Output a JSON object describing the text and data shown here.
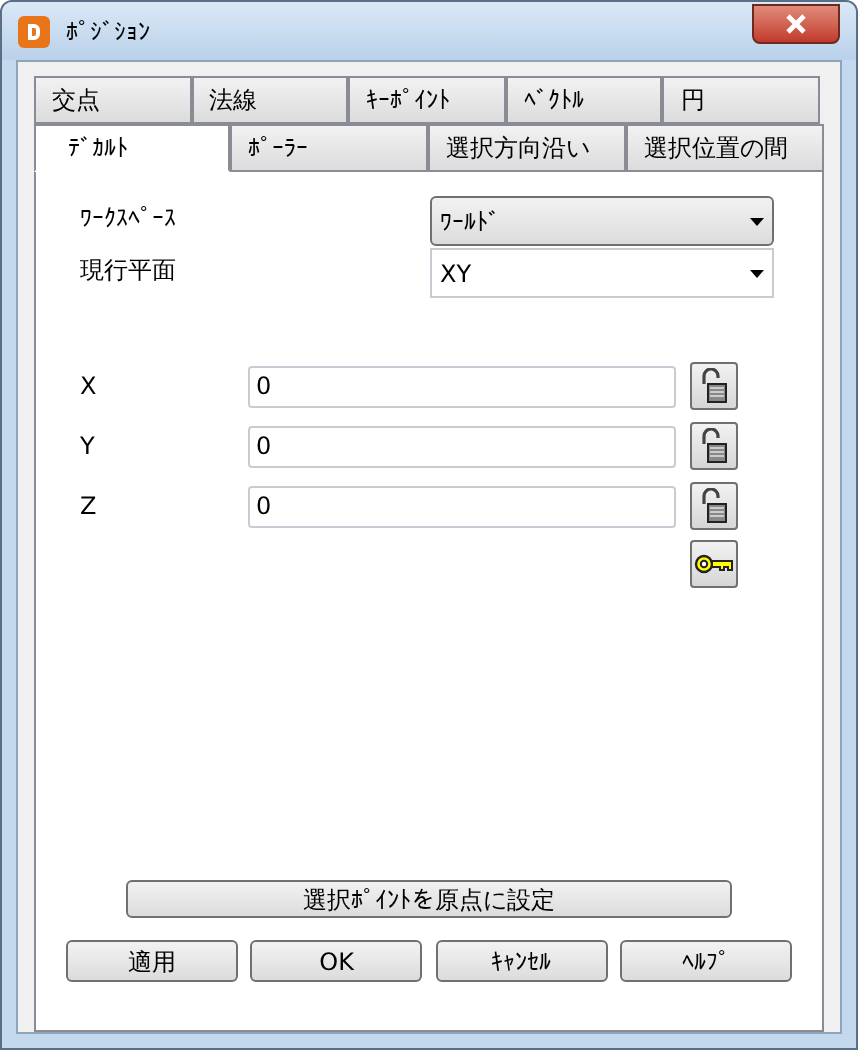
{
  "window": {
    "title": "ﾎﾟｼﾞｼｮﾝ"
  },
  "tab_rows": [
    [
      {
        "label": "交点",
        "selected": false
      },
      {
        "label": "法線",
        "selected": false
      },
      {
        "label": "ｷｰﾎﾟｲﾝﾄ",
        "selected": false
      },
      {
        "label": "ﾍﾞｸﾄﾙ",
        "selected": false
      },
      {
        "label": "円",
        "selected": false
      }
    ],
    [
      {
        "label": "ﾃﾞｶﾙﾄ",
        "selected": true
      },
      {
        "label": "ﾎﾟｰﾗｰ",
        "selected": false
      },
      {
        "label": "選択方向沿い",
        "selected": false
      },
      {
        "label": "選択位置の間",
        "selected": false
      }
    ]
  ],
  "dropdowns": [
    {
      "label": "ﾜｰｸｽﾍﾟｰｽ",
      "value": "ﾜｰﾙﾄﾞ",
      "kind": "button"
    },
    {
      "label": "現行平面",
      "value": "XY",
      "kind": "field"
    }
  ],
  "coordinates": [
    {
      "label": "X",
      "value": "0"
    },
    {
      "label": "Y",
      "value": "0"
    },
    {
      "label": "Z",
      "value": "0"
    }
  ],
  "set_origin_button": "選択ﾎﾟｲﾝﾄを原点に設定",
  "buttons": [
    "適用",
    "OK",
    "ｷｬﾝｾﾙ",
    "ﾍﾙﾌﾟ"
  ]
}
